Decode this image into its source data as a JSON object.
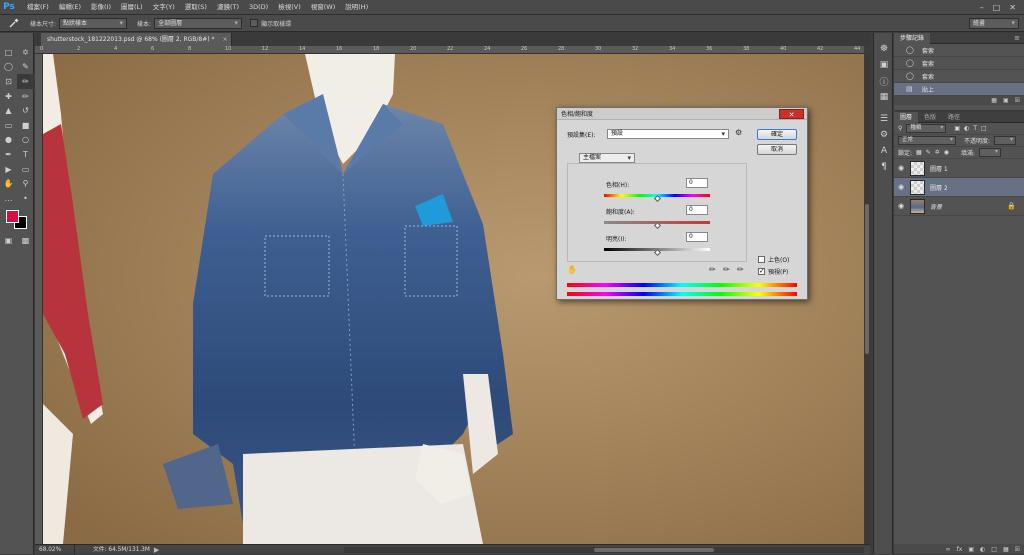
{
  "app": {
    "logo": "Ps"
  },
  "menu": [
    "檔案(F)",
    "編輯(E)",
    "影像(I)",
    "圖層(L)",
    "文字(Y)",
    "選取(S)",
    "濾鏡(T)",
    "3D(D)",
    "檢視(V)",
    "視窗(W)",
    "說明(H)"
  ],
  "options_bar": {
    "sample_size_label": "樣本尺寸:",
    "sample_size_value": "點狀樣本",
    "sample_label": "樣本:",
    "sample_value": "全部圖層",
    "show_ring_label": "顯示取樣環",
    "workspace": "繪畫"
  },
  "document": {
    "tab_title": "shutterstock_181222013.psd @ 68% (圖層 2, RGB/8#) *",
    "ruler_top": [
      "0",
      "2",
      "4",
      "6",
      "8",
      "10",
      "12",
      "14",
      "16",
      "18",
      "20",
      "22",
      "24",
      "26",
      "28",
      "30",
      "32",
      "34",
      "36",
      "38",
      "40",
      "42",
      "44"
    ]
  },
  "status": {
    "zoom": "68.02%",
    "doc_info": "文件: 64.5M/131.3M"
  },
  "history_panel": {
    "tab": "步驟記錄",
    "items": [
      {
        "label": "套索",
        "active": false
      },
      {
        "label": "套索",
        "active": false
      },
      {
        "label": "套索",
        "active": false
      },
      {
        "label": "貼上",
        "active": true
      }
    ]
  },
  "layers_panel": {
    "tabs": [
      "圖層",
      "色版",
      "路徑"
    ],
    "kind_label": "種類",
    "blend_mode": "正常",
    "opacity_label": "不透明度:",
    "lock_label": "鎖定:",
    "fill_label": "填滿:",
    "layers": [
      {
        "name": "圖層 1",
        "selected": false,
        "thumb": "transparent"
      },
      {
        "name": "圖層 2",
        "selected": true,
        "thumb": "transparent"
      },
      {
        "name": "背景",
        "selected": false,
        "thumb": "photo"
      }
    ]
  },
  "hue_sat_dialog": {
    "title": "色相/飽和度",
    "preset_label": "預設集(E):",
    "preset_value": "預設",
    "ok_label": "確定",
    "cancel_label": "取消",
    "channel": "主檔案",
    "hue_label": "色相(H):",
    "hue_value": "0",
    "sat_label": "飽和度(A):",
    "sat_value": "0",
    "light_label": "明亮(I):",
    "light_value": "0",
    "colorize_label": "上色(O)",
    "colorize_checked": false,
    "preview_label": "預視(P)",
    "preview_checked": true
  }
}
